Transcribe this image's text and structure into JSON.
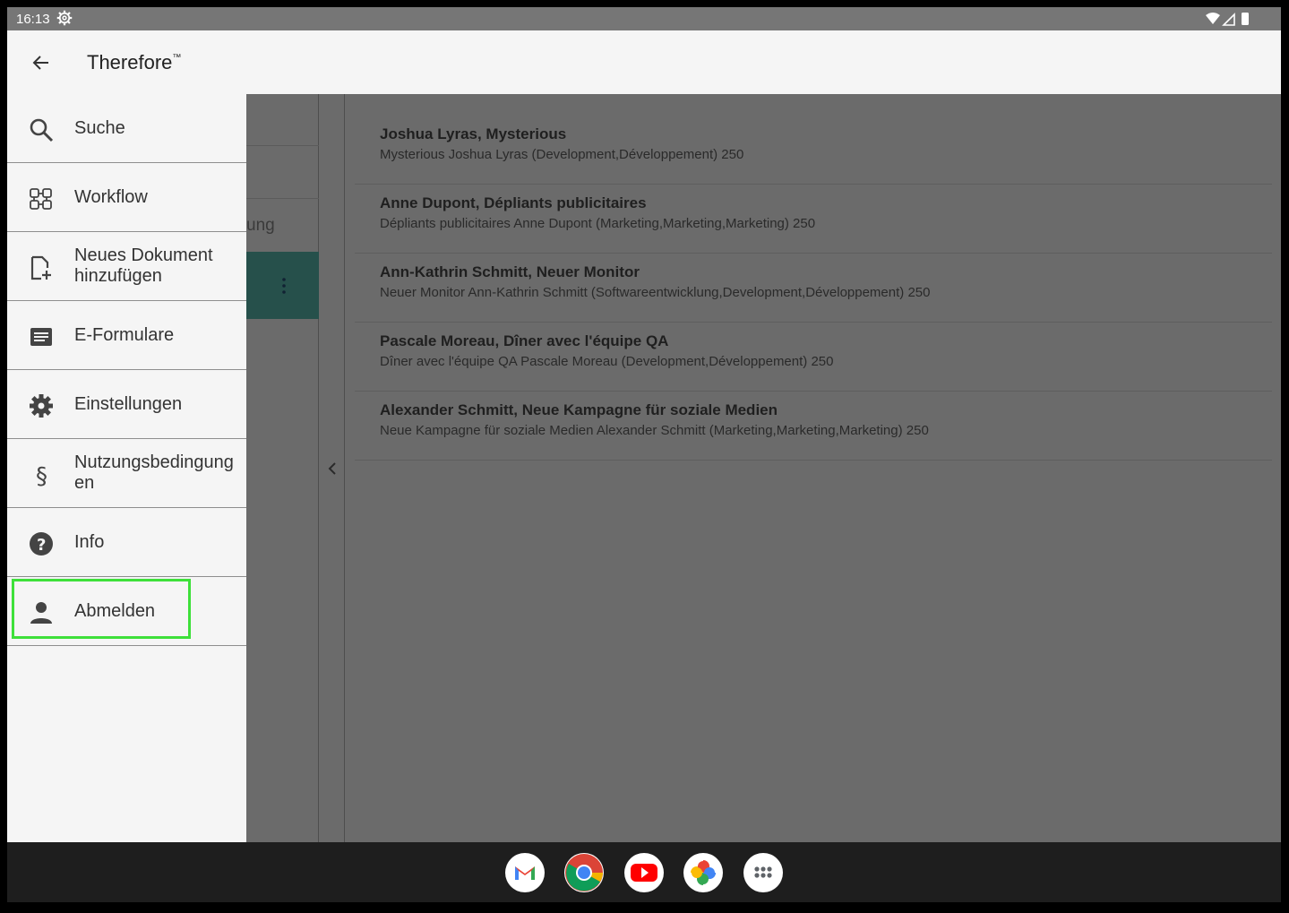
{
  "status_bar": {
    "time": "16:13"
  },
  "app_bar": {
    "title": "Therefore",
    "trademark": "™"
  },
  "drawer": {
    "items": [
      {
        "label": "Suche",
        "icon": "search-icon"
      },
      {
        "label": "Workflow",
        "icon": "workflow-icon"
      },
      {
        "label": "Neues Dokument hinzufügen",
        "icon": "add-document-icon"
      },
      {
        "label": "E-Formulare",
        "icon": "form-icon"
      },
      {
        "label": "Einstellungen",
        "icon": "gear-icon"
      },
      {
        "label": "Nutzungsbedingungen",
        "icon": "paragraph-icon"
      },
      {
        "label": "Info",
        "icon": "help-icon"
      },
      {
        "label": "Abmelden",
        "icon": "person-icon"
      }
    ],
    "labels_wrapped": {
      "item2_line1": "Neues Dokument",
      "item2_line2": "hinzufügen",
      "item5_line1": "Nutzungsbedingung",
      "item5_line2": "en"
    }
  },
  "middle_column": {
    "partial_text": "ung"
  },
  "results": [
    {
      "title": "Joshua Lyras, Mysterious",
      "subtitle": "Mysterious Joshua Lyras (Development,Développement) 250"
    },
    {
      "title": "Anne Dupont, Dépliants publicitaires",
      "subtitle": "Dépliants publicitaires Anne Dupont (Marketing,Marketing,Marketing) 250"
    },
    {
      "title": "Ann-Kathrin Schmitt, Neuer Monitor",
      "subtitle": "Neuer Monitor Ann-Kathrin Schmitt (Softwareentwicklung,Development,Développement) 250"
    },
    {
      "title": "Pascale Moreau, Dîner avec l'équipe QA",
      "subtitle": "Dîner avec l'équipe QA Pascale Moreau (Development,Développement) 250"
    },
    {
      "title": "Alexander Schmitt, Neue Kampagne für soziale Medien",
      "subtitle": "Neue Kampagne für soziale Medien Alexander Schmitt (Marketing,Marketing,Marketing) 250"
    }
  ],
  "dock": {
    "apps": [
      "gmail-icon",
      "chrome-icon",
      "youtube-icon",
      "photos-icon",
      "app-drawer-icon"
    ]
  },
  "colors": {
    "highlight": "#3ee03a",
    "teal": "#26504b",
    "drawer_bg": "#f5f5f5"
  }
}
